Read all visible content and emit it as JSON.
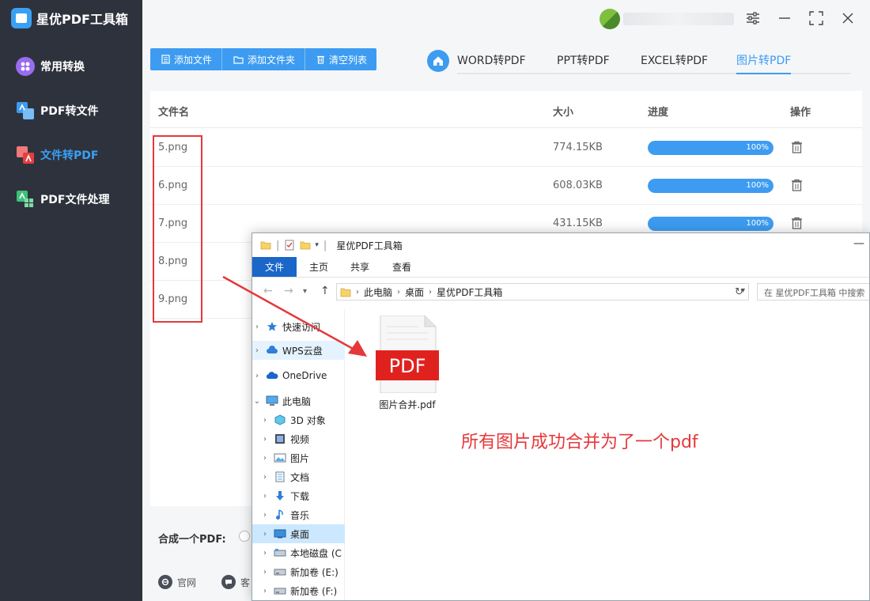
{
  "app": {
    "title": "星优PDF工具箱",
    "accent_color": "#3d9cf1"
  },
  "sidebar": {
    "items": [
      {
        "label": "常用转换",
        "icon": "grid-icon",
        "active": false
      },
      {
        "label": "PDF转文件",
        "icon": "pdf-to-file-icon",
        "active": false
      },
      {
        "label": "文件转PDF",
        "icon": "file-to-pdf-icon",
        "active": true
      },
      {
        "label": "PDF文件处理",
        "icon": "pdf-process-icon",
        "active": false
      }
    ]
  },
  "toolbar": {
    "add_file": "添加文件",
    "add_folder": "添加文件夹",
    "clear_list": "清空列表"
  },
  "tabs": [
    {
      "label": "WORD转PDF",
      "active": false
    },
    {
      "label": "PPT转PDF",
      "active": false
    },
    {
      "label": "EXCEL转PDF",
      "active": false
    },
    {
      "label": "图片转PDF",
      "active": true
    }
  ],
  "table": {
    "headers": {
      "name": "文件名",
      "size": "大小",
      "progress": "进度",
      "action": "操作"
    },
    "rows": [
      {
        "name": "5.png",
        "size": "774.15KB",
        "progress_text": "100%",
        "progress": 1.0
      },
      {
        "name": "6.png",
        "size": "608.03KB",
        "progress_text": "100%",
        "progress": 1.0
      },
      {
        "name": "7.png",
        "size": "431.15KB",
        "progress_text": "100%",
        "progress": 1.0
      },
      {
        "name": "8.png"
      },
      {
        "name": "9.png"
      }
    ]
  },
  "bottom": {
    "merge_label": "合成一个PDF:",
    "link_official": "官网",
    "link_service": "客"
  },
  "explorer": {
    "title": "星优PDF工具箱",
    "ribbon": [
      "文件",
      "主页",
      "共享",
      "查看"
    ],
    "address": [
      "此电脑",
      "桌面",
      "星优PDF工具箱"
    ],
    "search_placeholder": "在 星优PDF工具箱 中搜索",
    "tree": [
      {
        "label": "快速访问",
        "icon": "star-icon",
        "expanded": false
      },
      {
        "label": "WPS云盘",
        "icon": "cloud-icon",
        "expanded": false
      },
      {
        "label": "OneDrive",
        "icon": "onedrive-icon",
        "expanded": false
      },
      {
        "label": "此电脑",
        "icon": "computer-icon",
        "expanded": true
      },
      {
        "label": "3D 对象",
        "icon": "cube-icon"
      },
      {
        "label": "视频",
        "icon": "video-icon"
      },
      {
        "label": "图片",
        "icon": "picture-icon"
      },
      {
        "label": "文档",
        "icon": "document-icon"
      },
      {
        "label": "下载",
        "icon": "download-icon"
      },
      {
        "label": "音乐",
        "icon": "music-icon"
      },
      {
        "label": "桌面",
        "icon": "desktop-icon",
        "selected": true
      },
      {
        "label": "本地磁盘 (C",
        "icon": "drive-icon"
      },
      {
        "label": "新加卷 (E:)",
        "icon": "drive-icon"
      },
      {
        "label": "新加卷 (F:)",
        "icon": "drive-icon"
      }
    ],
    "file": {
      "name": "图片合并.pdf",
      "badge": "PDF"
    }
  },
  "annotation": "所有图片成功合并为了一个pdf"
}
